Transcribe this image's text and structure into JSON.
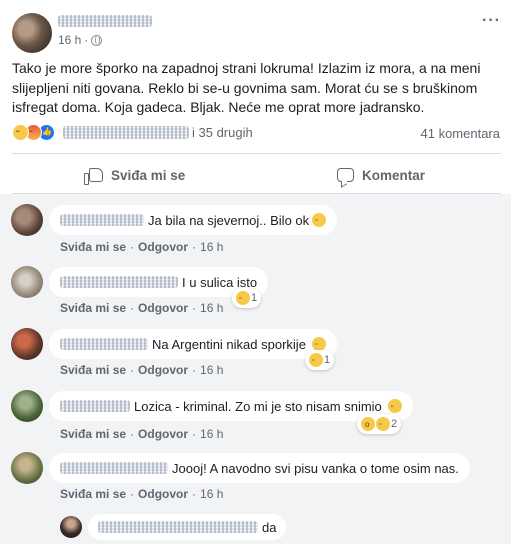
{
  "post": {
    "time": "16 h",
    "separator": "·",
    "text": "Tako je more šporko na zapadnoj strani lokruma! Izlazim iz mora, a na meni slijepljeni niti govana. Reklo bi se-u govnima sam. Morat ću se s bruškinom isfregat doma. Koja gadeca. Bljak. Neće me oprat more jadransko.",
    "reactions_others": "i 35 drugih",
    "comments_count": "41 komentara",
    "reaction_icons": [
      "sad-reaction",
      "angry-reaction",
      "like-reaction"
    ]
  },
  "actions": {
    "like_label": "Sviđa mi se",
    "comment_label": "Komentar"
  },
  "comments": [
    {
      "text": "Ja bila na sjevernoj.. Bilo ok",
      "emoji": "thinking-face",
      "like": "Sviđa mi se",
      "reply": "Odgovor",
      "time": "16 h",
      "sep": "·",
      "reaction_count": ""
    },
    {
      "text": "I u sulica isto",
      "emoji": "",
      "like": "Sviđa mi se",
      "reply": "Odgovor",
      "time": "16 h",
      "sep": "·",
      "reaction_count": "1"
    },
    {
      "text": "Na Argentini nikad sporkije",
      "emoji": "disappointed-face",
      "like": "Sviđa mi se",
      "reply": "Odgovor",
      "time": "16 h",
      "sep": "·",
      "reaction_count": "1"
    },
    {
      "text": "Lozica - kriminal. Zo mi je sto nisam snimio",
      "emoji": "pensive-face",
      "like": "Sviđa mi se",
      "reply": "Odgovor",
      "time": "16 h",
      "sep": "·",
      "reaction_count": "2"
    },
    {
      "text": "Joooj! A navodno svi pisu vanka o tome osim nas.",
      "emoji": "",
      "like": "Sviđa mi se",
      "reply": "Odgovor",
      "time": "16 h",
      "sep": "·",
      "reaction_count": ""
    }
  ],
  "reply_preview": {
    "text": "da"
  },
  "colors": {
    "accent": "#1877f2",
    "muted": "#606770",
    "comments_bg": "#f2f3f5"
  }
}
